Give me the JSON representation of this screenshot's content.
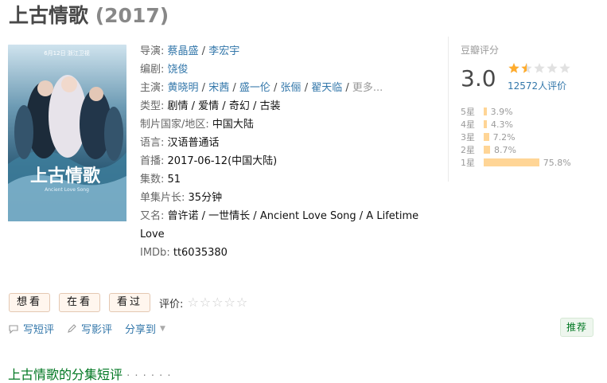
{
  "title": "上古情歌",
  "year": "(2017)",
  "poster": {
    "date_text": "6月12日  浙江卫视",
    "logo_text": "上古情歌",
    "logo_sub": "Ancient Love Song"
  },
  "info": {
    "director_label": "导演:",
    "directors": [
      "蔡晶盛",
      "李宏宇"
    ],
    "writer_label": "编剧:",
    "writers": [
      "饶俊"
    ],
    "cast_label": "主演:",
    "cast": [
      "黄晓明",
      "宋茜",
      "盛一伦",
      "张俪",
      "翟天临"
    ],
    "cast_more": "更多...",
    "genre_label": "类型:",
    "genre_value": "剧情 / 爱情 / 奇幻 / 古装",
    "country_label": "制片国家/地区:",
    "country_value": "中国大陆",
    "language_label": "语言:",
    "language_value": "汉语普通话",
    "premiere_label": "首播:",
    "premiere_value": "2017-06-12(中国大陆)",
    "episodes_label": "集数:",
    "episodes_value": "51",
    "runtime_label": "单集片长:",
    "runtime_value": "35分钟",
    "aka_label": "又名:",
    "aka_value": "曾许诺 / 一世情长 / Ancient Love Song / A Lifetime Love",
    "imdb_label": "IMDb:",
    "imdb_value": "tt6035380"
  },
  "rating": {
    "label": "豆瓣评分",
    "score": "3.0",
    "stars": 1.5,
    "count": "12572人评价",
    "distribution": [
      {
        "label": "5星",
        "percent": 3.9,
        "text": "3.9%"
      },
      {
        "label": "4星",
        "percent": 4.3,
        "text": "4.3%"
      },
      {
        "label": "3星",
        "percent": 7.2,
        "text": "7.2%"
      },
      {
        "label": "2星",
        "percent": 8.7,
        "text": "8.7%"
      },
      {
        "label": "1星",
        "percent": 75.8,
        "text": "75.8%"
      }
    ]
  },
  "actions": {
    "want": "想看",
    "watching": "在看",
    "watched": "看过",
    "rate_label": "评价:"
  },
  "links": {
    "short_review": "写短评",
    "review": "写影评",
    "share": "分享到"
  },
  "recommend": "推荐",
  "section": {
    "title": "上古情歌的分集短评",
    "dots": "· · · · · ·"
  },
  "colors": {
    "link": "#3377aa",
    "green": "#007722",
    "bar": "#ffd596",
    "star": "#ffac2d"
  }
}
